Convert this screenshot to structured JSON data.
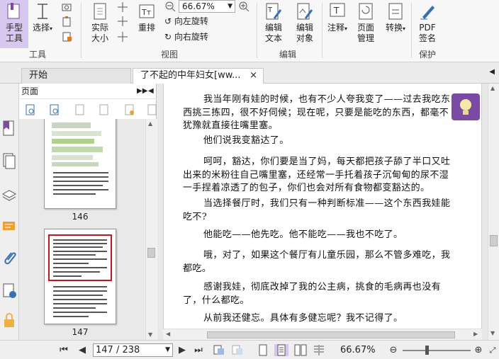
{
  "ribbon": {
    "hand_tool": "手型\n工具",
    "select": "选择",
    "actual_size": "实际\n大小",
    "reflow": "重排",
    "zoom_value": "66.67%",
    "rotate_left": "向左旋转",
    "rotate_right": "向右旋转",
    "edit_text": "编辑\n文本",
    "edit_object": "编辑\n对象",
    "comment": "注释",
    "page_manage": "页面\n管理",
    "convert": "转换",
    "pdf_sign": "PDF\n签名",
    "groups": {
      "tools": "工具",
      "view": "视图",
      "edit": "编辑",
      "protect": "保护"
    }
  },
  "tabs": [
    {
      "label": "开始"
    },
    {
      "label": "了不起的中年妇女[ww...",
      "close": "×"
    }
  ],
  "panel": {
    "title": "页面",
    "thumbnails": [
      {
        "label": "146"
      },
      {
        "label": "147"
      }
    ]
  },
  "document": {
    "paragraphs": [
      "我当年刚有娃的时候，也有不少人夸我变了——过去我吃东西挑三拣四，很不好伺候；现在呢，只要是能吃的东西，都毫不犹豫就直接往嘴里塞。",
      "他们说我变豁达了。",
      "呵呵，豁达，你们要是当了妈，每天都把孩子舔了半口又吐出来的米粉往自己嘴里塞，还经常一手托着孩子沉甸甸的尿不湿一手捏着凉透了的包子，你们也会对所有食物都变豁达的。",
      "当选择餐厅时，我们只有一种判断标准——这个东西我娃能吃不?",
      "他能吃——他先吃。他不能吃——我也不吃了。",
      "哦，对了，如果这个餐厅有儿童乐园，那么不管多难吃，我都吃。",
      "感谢我娃，彻底改掉了我的公主病，挑食的毛病再也没有了，什么都吃。",
      "从前我还健忘。具体有多健忘呢？我不记得了。"
    ]
  },
  "status": {
    "page_input": "147 / 238",
    "zoom": "66.67%"
  },
  "colors": {
    "accent": "#7b4aa3",
    "hand_bg": "#d8c8ef",
    "selected_thumb_border": "#c0161d"
  }
}
